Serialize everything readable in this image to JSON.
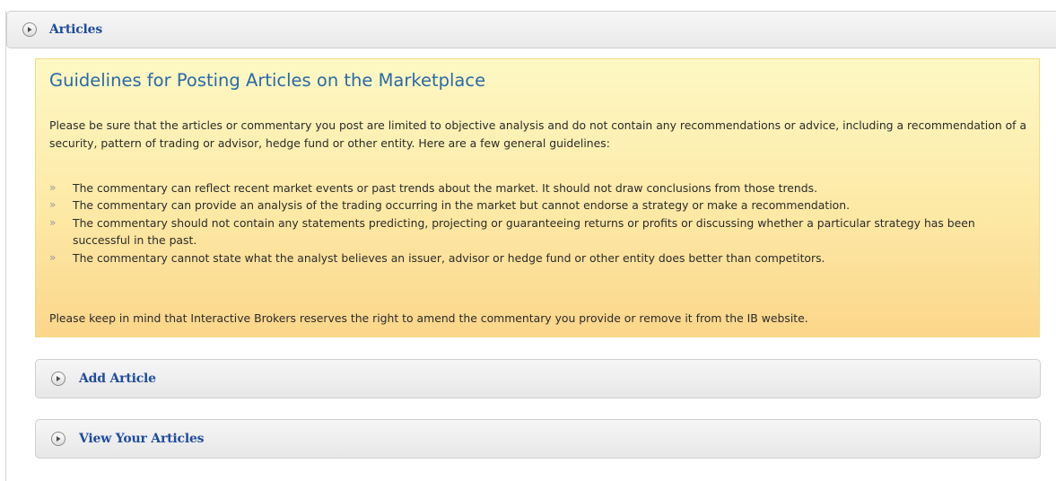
{
  "section": {
    "title": "Articles",
    "icon": "expand-arrow-icon"
  },
  "guidelines": {
    "title": "Guidelines for Posting Articles on the Marketplace",
    "intro": "Please be sure that the articles or commentary you post are limited to objective analysis and do not contain any recommendations or advice, including a recommendation of a security, pattern of trading or advisor, hedge fund or other entity. Here are a few general guidelines:",
    "bullet_symbol": "»",
    "items": [
      "The commentary can reflect recent market events or past trends about the market. It should not draw conclusions from those trends.",
      "The commentary can provide an analysis of the trading occurring in the market but cannot endorse a strategy or make a recommendation.",
      "The commentary should not contain any statements predicting, projecting or guaranteeing returns or profits or discussing whether a particular strategy has been successful in the past.",
      "The commentary cannot state what the analyst believes an issuer, advisor or hedge fund or other entity does better than competitors."
    ],
    "note": "Please keep in mind that Interactive Brokers reserves the right to amend the commentary you provide or remove it from the IB website."
  },
  "actions": {
    "add_article": "Add Article",
    "view_articles": "View Your Articles"
  },
  "colors": {
    "header_text": "#1f4c9c",
    "title_text": "#2a6aa8",
    "notice_top": "#fdf8c4",
    "notice_bottom": "#fbd68a"
  }
}
